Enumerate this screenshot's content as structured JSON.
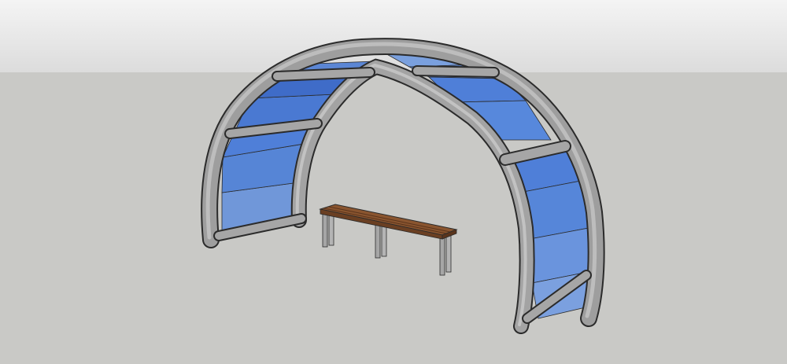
{
  "scene": {
    "subject": "arched-shelter-with-bench",
    "colors": {
      "sky_top": "#f4f4f4",
      "sky_bottom": "#dcdcdc",
      "ground": "#c9c9c6",
      "frame": "#9a9a9a",
      "frame_light": "#b3b3b3",
      "frame_dark": "#6e6e6e",
      "outline": "#2b2b2b",
      "panel_blue": "#4f7fd8",
      "panel_blue_light": "#6f97de",
      "panel_blue_dark": "#3b67c4",
      "bench_wood": "#7a4a2a",
      "bench_wood_light": "#9a6038",
      "bench_leg": "#a6a6a6"
    }
  }
}
